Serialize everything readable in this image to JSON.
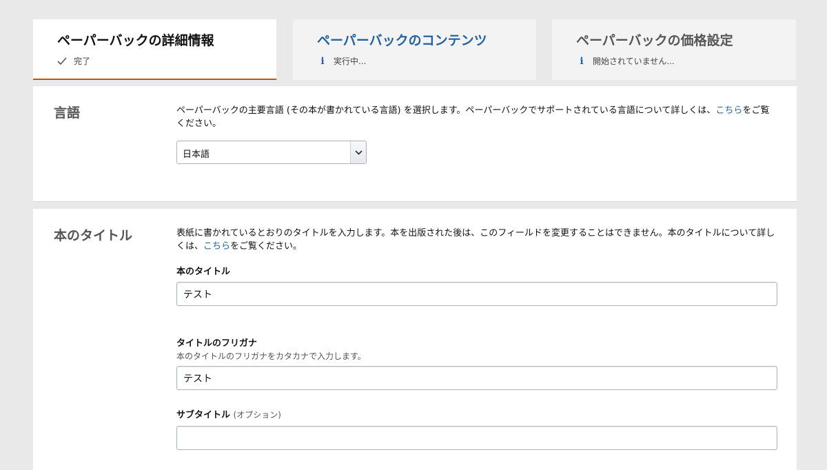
{
  "tabs": [
    {
      "title": "ペーパーバックの詳細情報",
      "status": "完了",
      "icon": "check-icon"
    },
    {
      "title": "ペーパーバックのコンテンツ",
      "status": "実行中...",
      "icon": "info-icon"
    },
    {
      "title": "ペーパーバックの価格設定",
      "status": "開始されていません...",
      "icon": "info-icon"
    }
  ],
  "language": {
    "heading": "言語",
    "description_before": "ペーパーバックの主要言語 (その本が書かれている言語) を選択します。ペーパーバックでサポートされている言語について詳しくは、",
    "link": "こちら",
    "description_after": "をご覧ください。",
    "selected": "日本語"
  },
  "title_section": {
    "heading": "本のタイトル",
    "description_before": "表紙に書かれているとおりのタイトルを入力します。本を出版された後は、このフィールドを変更することはできません。本のタイトルについて詳しくは、",
    "link": "こちら",
    "description_after": "をご覧ください。",
    "book_title": {
      "label": "本のタイトル",
      "value": "テスト"
    },
    "furigana": {
      "label": "タイトルのフリガナ",
      "help": "本のタイトルのフリガナをカタカナで入力します。",
      "value": "テスト"
    },
    "subtitle": {
      "label": "サブタイトル",
      "optional": "(オプション)",
      "value": ""
    }
  },
  "colors": {
    "accent_underline": "#c45500",
    "link": "#2162a1",
    "background": "#e9e9e9"
  }
}
